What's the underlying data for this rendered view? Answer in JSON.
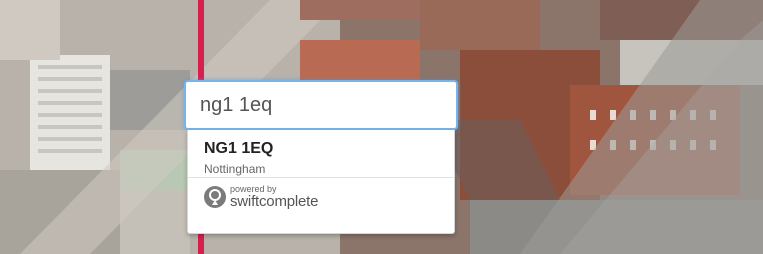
{
  "search": {
    "value": "ng1 1eq"
  },
  "suggestions": [
    {
      "primary": "NG1 1EQ",
      "secondary": "Nottingham"
    }
  ],
  "branding": {
    "powered_by": "powered by",
    "brand": "swiftcomplete",
    "icon": "location-pin-icon"
  },
  "colors": {
    "accent": "#d61f4f",
    "focus_border": "#7ab3e8"
  }
}
